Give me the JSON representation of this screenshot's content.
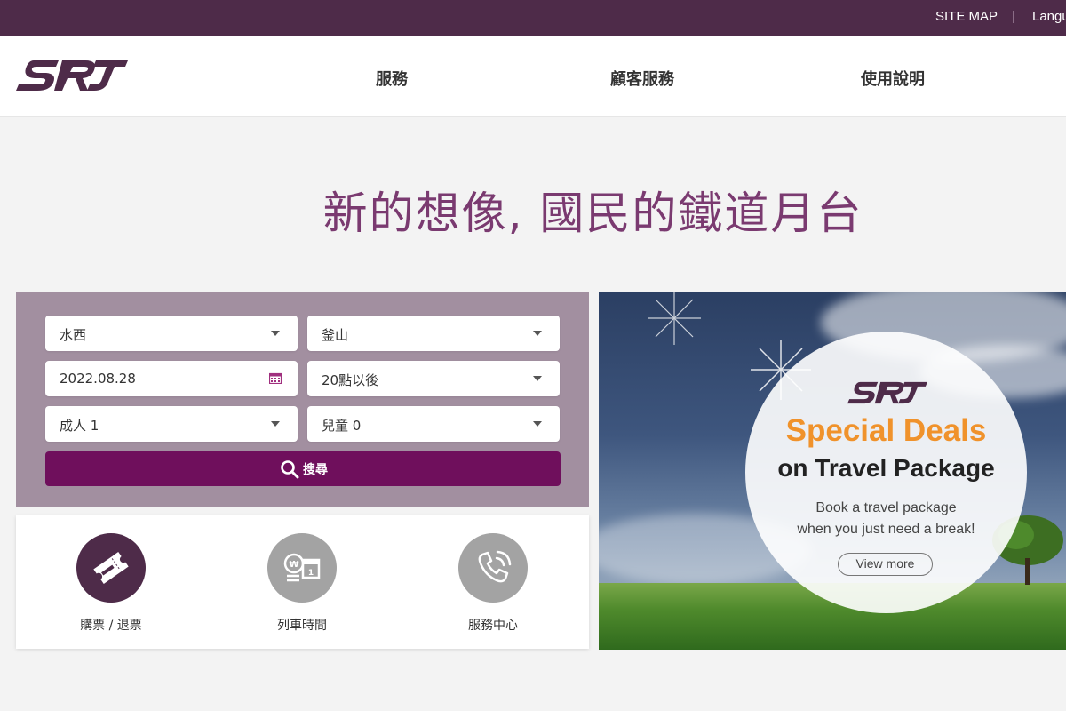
{
  "topbar": {
    "sitemap": "SITE MAP",
    "language": "Langu"
  },
  "header": {
    "nav": [
      {
        "label": "服務"
      },
      {
        "label": "顧客服務"
      },
      {
        "label": "使用說明"
      }
    ]
  },
  "headline": "新的想像, 國民的鐵道月台",
  "booking": {
    "departure": "水西",
    "arrival": "釜山",
    "date": "2022.08.28",
    "time": "20點以後",
    "adults": "成人 1",
    "children": "兒童 0",
    "search_label": "搜尋"
  },
  "quick_menu": [
    {
      "label": "購票 / 退票",
      "icon": "ticket-icon",
      "color": "#4e2b49"
    },
    {
      "label": "列車時間",
      "icon": "timetable-icon",
      "color": "#a3a3a3"
    },
    {
      "label": "服務中心",
      "icon": "phone-icon",
      "color": "#a3a3a3"
    }
  ],
  "banner": {
    "title1": "Special Deals",
    "title2": "on Travel Package",
    "sub1": "Book a travel package",
    "sub2": "when you just need a break!",
    "button": "View more"
  },
  "colors": {
    "brand": "#4e2b49",
    "accent": "#6f0f5c",
    "booking_bg": "#a28fa0",
    "deal_orange": "#f0922b"
  }
}
